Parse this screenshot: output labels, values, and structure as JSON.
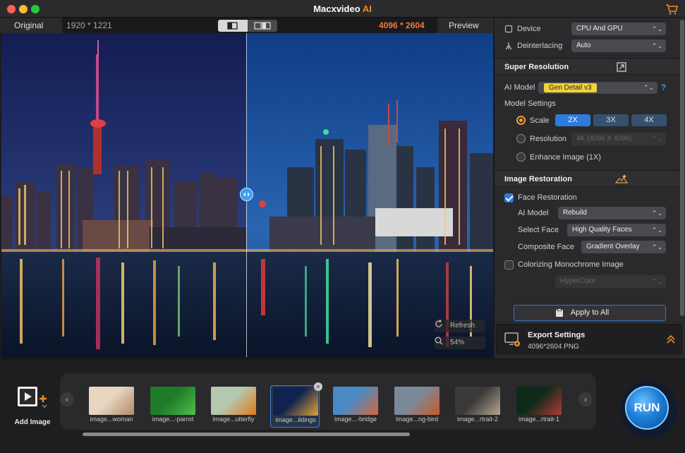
{
  "app": {
    "title_main": "Macxvideo",
    "title_ai": "AI"
  },
  "preview": {
    "original_label": "Original",
    "original_resolution": "1920 * 1221",
    "output_resolution": "4096 * 2604",
    "preview_label": "Preview",
    "refresh_label": "Refresh",
    "zoom": "54%"
  },
  "settings": {
    "device_label": "Device",
    "device_value": "CPU And GPU",
    "deinterlacing_label": "Deinterlacing",
    "deinterlacing_value": "Auto",
    "super_resolution": {
      "title": "Super Resolution",
      "ai_model_label": "AI Model",
      "ai_model_value": "Gen Detail v3",
      "help": "?",
      "model_settings_label": "Model Settings",
      "scale_label": "Scale",
      "scale_options": [
        "2X",
        "3X",
        "4X"
      ],
      "scale_selected": "2X",
      "resolution_label": "Resolution",
      "resolution_value": "4K (4096 X 4096)",
      "enhance_label": "Enhance Image (1X)"
    },
    "image_restoration": {
      "title": "Image Restoration",
      "face_restoration_label": "Face Restoration",
      "face_restoration_checked": true,
      "ai_model_label": "AI Model",
      "ai_model_value": "Rebuild",
      "select_face_label": "Select Face",
      "select_face_value": "High Quality Faces",
      "composite_face_label": "Composite Face",
      "composite_face_value": "Gradient Overlay",
      "colorizing_label": "Colorizing Monochrome Image",
      "colorizing_checked": false,
      "colorizing_value": "HyperColor"
    },
    "apply_to_all_label": "Apply to All",
    "export": {
      "title": "Export Settings",
      "value": "4096*2604 PNG"
    }
  },
  "filmstrip": {
    "add_image_label": "Add Image",
    "items": [
      {
        "caption": "image...woman",
        "colors": [
          "#e8d6c2",
          "#b08a6a"
        ]
      },
      {
        "caption": "image...-parrot",
        "colors": [
          "#1f7a2a",
          "#4cc24a"
        ]
      },
      {
        "caption": "image...utterfly",
        "colors": [
          "#b4c8b0",
          "#e07a1a"
        ]
      },
      {
        "caption": "image...ildings",
        "colors": [
          "#10224e",
          "#e4a23a"
        ]
      },
      {
        "caption": "image...-bridge",
        "colors": [
          "#4a8ac4",
          "#d4683a"
        ]
      },
      {
        "caption": "image...ng-bird",
        "colors": [
          "#7a8a9a",
          "#c85a2a"
        ]
      },
      {
        "caption": "image...rtrait-2",
        "colors": [
          "#3a3a3a",
          "#b8a494"
        ]
      },
      {
        "caption": "image...rtrait-1",
        "colors": [
          "#0e2a18",
          "#b23a3a"
        ]
      }
    ],
    "selected_index": 3,
    "run_label": "RUN"
  }
}
